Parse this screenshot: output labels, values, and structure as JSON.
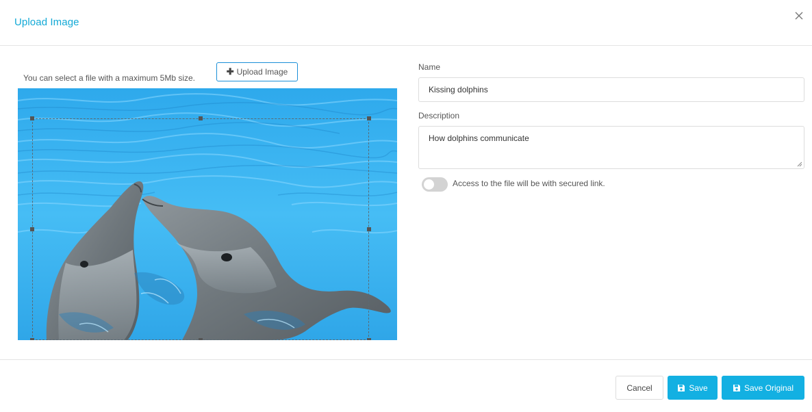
{
  "dialog": {
    "title": "Upload Image",
    "close_icon": "close-icon"
  },
  "upload": {
    "hint": "You can select a file with a maximum 5Mb size.",
    "button_label": "Upload Image",
    "button_icon": "plus-icon"
  },
  "preview": {
    "image_subject": "two dolphins kissing in blue water"
  },
  "form": {
    "name_label": "Name",
    "name_value": "Kissing dolphins",
    "description_label": "Description",
    "description_value": "How dolphins communicate",
    "secure_toggle_state": "off",
    "secure_toggle_label": "Access to the file will be with secured link."
  },
  "footer": {
    "cancel_label": "Cancel",
    "save_label": "Save",
    "save_original_label": "Save Original",
    "save_icon": "floppy-disk-icon"
  },
  "colors": {
    "accent": "#13b0e2",
    "title": "#12a9d6",
    "water": "#3fb7f2"
  }
}
